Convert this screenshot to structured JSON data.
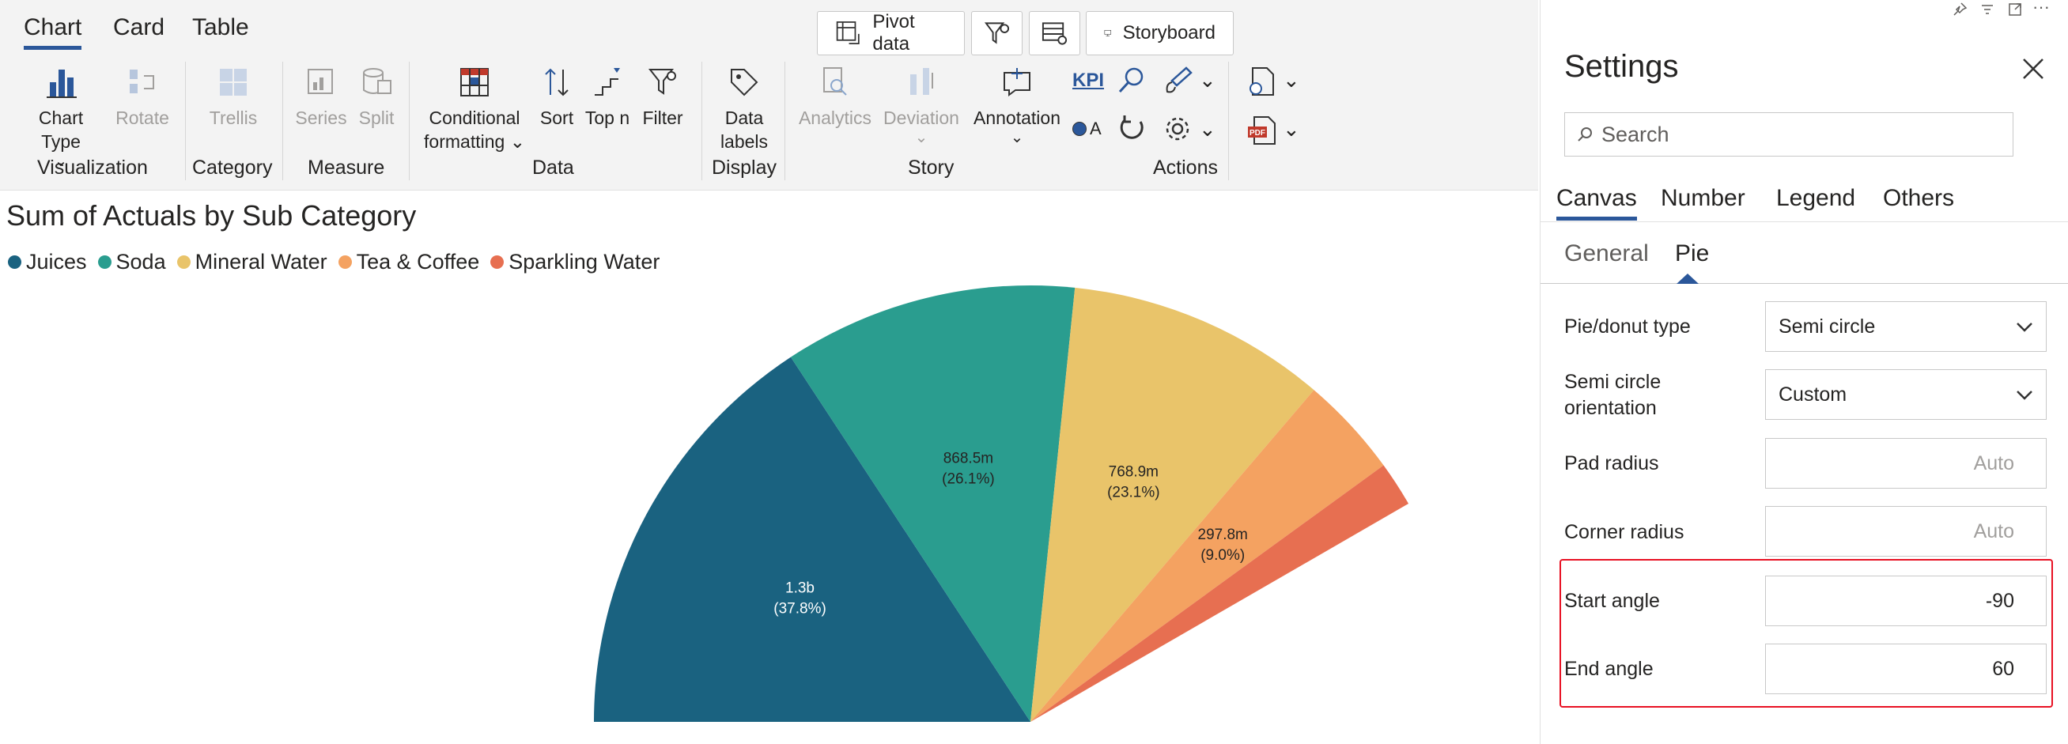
{
  "tabs": [
    "Chart",
    "Card",
    "Table"
  ],
  "top_buttons": {
    "pivot": "Pivot data",
    "storyboard": "Storyboard"
  },
  "ribbon": {
    "chart_type": "Chart Type",
    "rotate": "Rotate",
    "trellis": "Trellis",
    "series": "Series",
    "split": "Split",
    "conditional": "Conditional",
    "formatting": "formatting",
    "sort": "Sort",
    "top_n": "Top n",
    "filter": "Filter",
    "data": "Data",
    "labels": "labels",
    "analytics": "Analytics",
    "deviation": "Deviation",
    "annotation": "Annotation",
    "kpi": "KPI",
    "a_label": "A",
    "groups": {
      "visualization": "Visualization",
      "category": "Category",
      "measure": "Measure",
      "data": "Data",
      "display": "Display",
      "story": "Story",
      "actions": "Actions"
    }
  },
  "chart_title": {
    "bold": "Sum of Actuals",
    "rest": "by Sub Category"
  },
  "legend": [
    {
      "name": "Juices",
      "color": "#1a6280"
    },
    {
      "name": "Soda",
      "color": "#2a9d8f"
    },
    {
      "name": "Mineral Water",
      "color": "#e9c46a"
    },
    {
      "name": "Tea & Coffee",
      "color": "#f4a261"
    },
    {
      "name": "Sparkling Water",
      "color": "#e76f51"
    }
  ],
  "chart_data": {
    "type": "pie",
    "variant": "semi-circle",
    "start_angle": -90,
    "end_angle": 60,
    "slices": [
      {
        "name": "Juices",
        "share": 37.8,
        "label": "1.3b",
        "pct_label": "(37.8%)",
        "color": "#1a6280"
      },
      {
        "name": "Soda",
        "share": 26.1,
        "label": "868.5m",
        "pct_label": "(26.1%)",
        "color": "#2a9d8f"
      },
      {
        "name": "Mineral Water",
        "share": 23.1,
        "label": "768.9m",
        "pct_label": "(23.1%)",
        "color": "#e9c46a"
      },
      {
        "name": "Tea & Coffee",
        "share": 9.0,
        "label": "297.8m",
        "pct_label": "(9.0%)",
        "color": "#f4a261"
      },
      {
        "name": "Sparkling Water",
        "share": 4.0,
        "label": "",
        "pct_label": "",
        "color": "#e76f51"
      }
    ]
  },
  "settings": {
    "title": "Settings",
    "search_placeholder": "Search",
    "tabs": [
      "Canvas",
      "Number",
      "Legend",
      "Others"
    ],
    "subtabs": [
      "General",
      "Pie"
    ],
    "rows": [
      {
        "label": "Pie/donut type",
        "value": "Semi circle"
      },
      {
        "label1": "Semi circle",
        "label2": "orientation",
        "value": "Custom"
      },
      {
        "label": "Pad radius",
        "value": "Auto"
      },
      {
        "label": "Corner radius",
        "value": "Auto"
      },
      {
        "label": "Start angle",
        "value": "-90"
      },
      {
        "label": "End angle",
        "value": "60"
      }
    ]
  }
}
